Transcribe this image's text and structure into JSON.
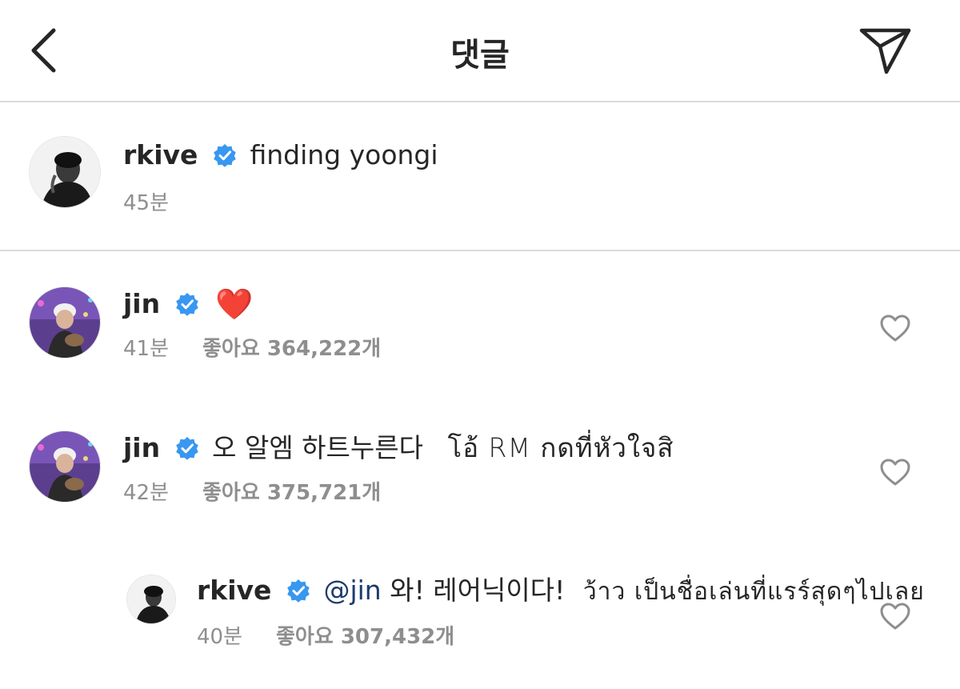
{
  "header": {
    "title": "댓글",
    "back_icon": "chevron-left-icon",
    "share_icon": "paper-plane-icon"
  },
  "caption": {
    "username": "rkive",
    "text": "finding yoongi",
    "time": "45분"
  },
  "comments": [
    {
      "username": "jin",
      "text": "",
      "emoji": "❤️",
      "time": "41분",
      "likes": "좋아요 364,222개"
    },
    {
      "username": "jin",
      "text": "오 알엠 하트누른다",
      "translation": "โอ้ RM กดที่หัวใจสิ",
      "time": "42분",
      "likes": "좋아요 375,721개"
    }
  ],
  "reply": {
    "username": "rkive",
    "mention": "@jin",
    "text": "와! 레어닉이다!",
    "translation": "ว้าว เป็นชื่อเล่นที่แรร์สุดๆไปเลย",
    "time": "40분",
    "likes": "좋아요 307,432개"
  },
  "colors": {
    "verified": "#3897f0",
    "meta_text": "#8e8e8e",
    "divider": "#dbdbdb",
    "mention": "#1d3b6d",
    "heart_emoji": "#e0242e"
  }
}
